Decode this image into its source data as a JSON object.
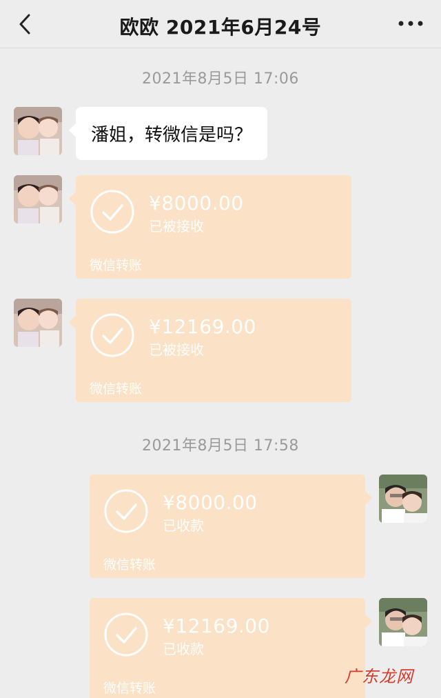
{
  "header": {
    "title": "欧欧 2021年6月24号"
  },
  "timestamps": [
    "2021年8月5日 17:06",
    "2021年8月5日 17:58"
  ],
  "messages": {
    "text1": "潘姐，转微信是吗？"
  },
  "transfers": [
    {
      "amount": "¥8000.00",
      "status": "已被接收",
      "footer": "微信转账"
    },
    {
      "amount": "¥12169.00",
      "status": "已被接收",
      "footer": "微信转账"
    },
    {
      "amount": "¥8000.00",
      "status": "已收款",
      "footer": "微信转账"
    },
    {
      "amount": "¥12169.00",
      "status": "已收款",
      "footer": "微信转账"
    }
  ],
  "watermark": "广东龙网",
  "colors": {
    "background": "#ededed",
    "bubble": "#ffffff",
    "transfer_card": "#fbe1c5"
  }
}
